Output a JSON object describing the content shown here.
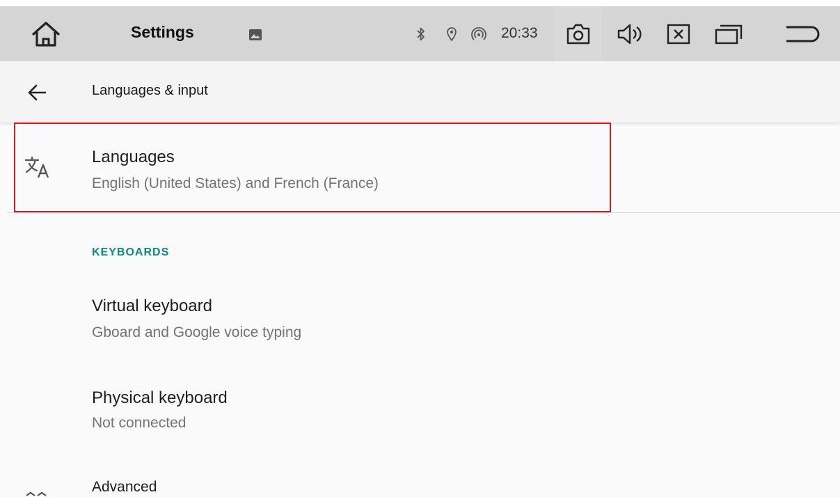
{
  "status_bar": {
    "app_title": "Settings",
    "time": "20:33",
    "icons": [
      "home-icon",
      "image-icon",
      "bluetooth-icon",
      "location-icon",
      "hotspot-icon",
      "screenshot-camera-icon",
      "volume-icon",
      "close-window-icon",
      "recent-apps-icon",
      "back-icon"
    ]
  },
  "app_bar": {
    "title": "Languages & input",
    "back_icon": "arrow-back-icon"
  },
  "languages": {
    "title": "Languages",
    "summary": "English (United States) and French (France)",
    "icon": "translate-icon"
  },
  "keyboards": {
    "header": "KEYBOARDS",
    "items": [
      {
        "title": "Virtual keyboard",
        "summary": "Gboard and Google voice typing"
      },
      {
        "title": "Physical keyboard",
        "summary": "Not connected"
      }
    ]
  },
  "advanced": {
    "title": "Advanced",
    "icon": "expand-more-icon"
  },
  "colors": {
    "accent": "#0f8a7e",
    "highlight": "#e0161c",
    "status_bar": "#d5d5d5"
  }
}
